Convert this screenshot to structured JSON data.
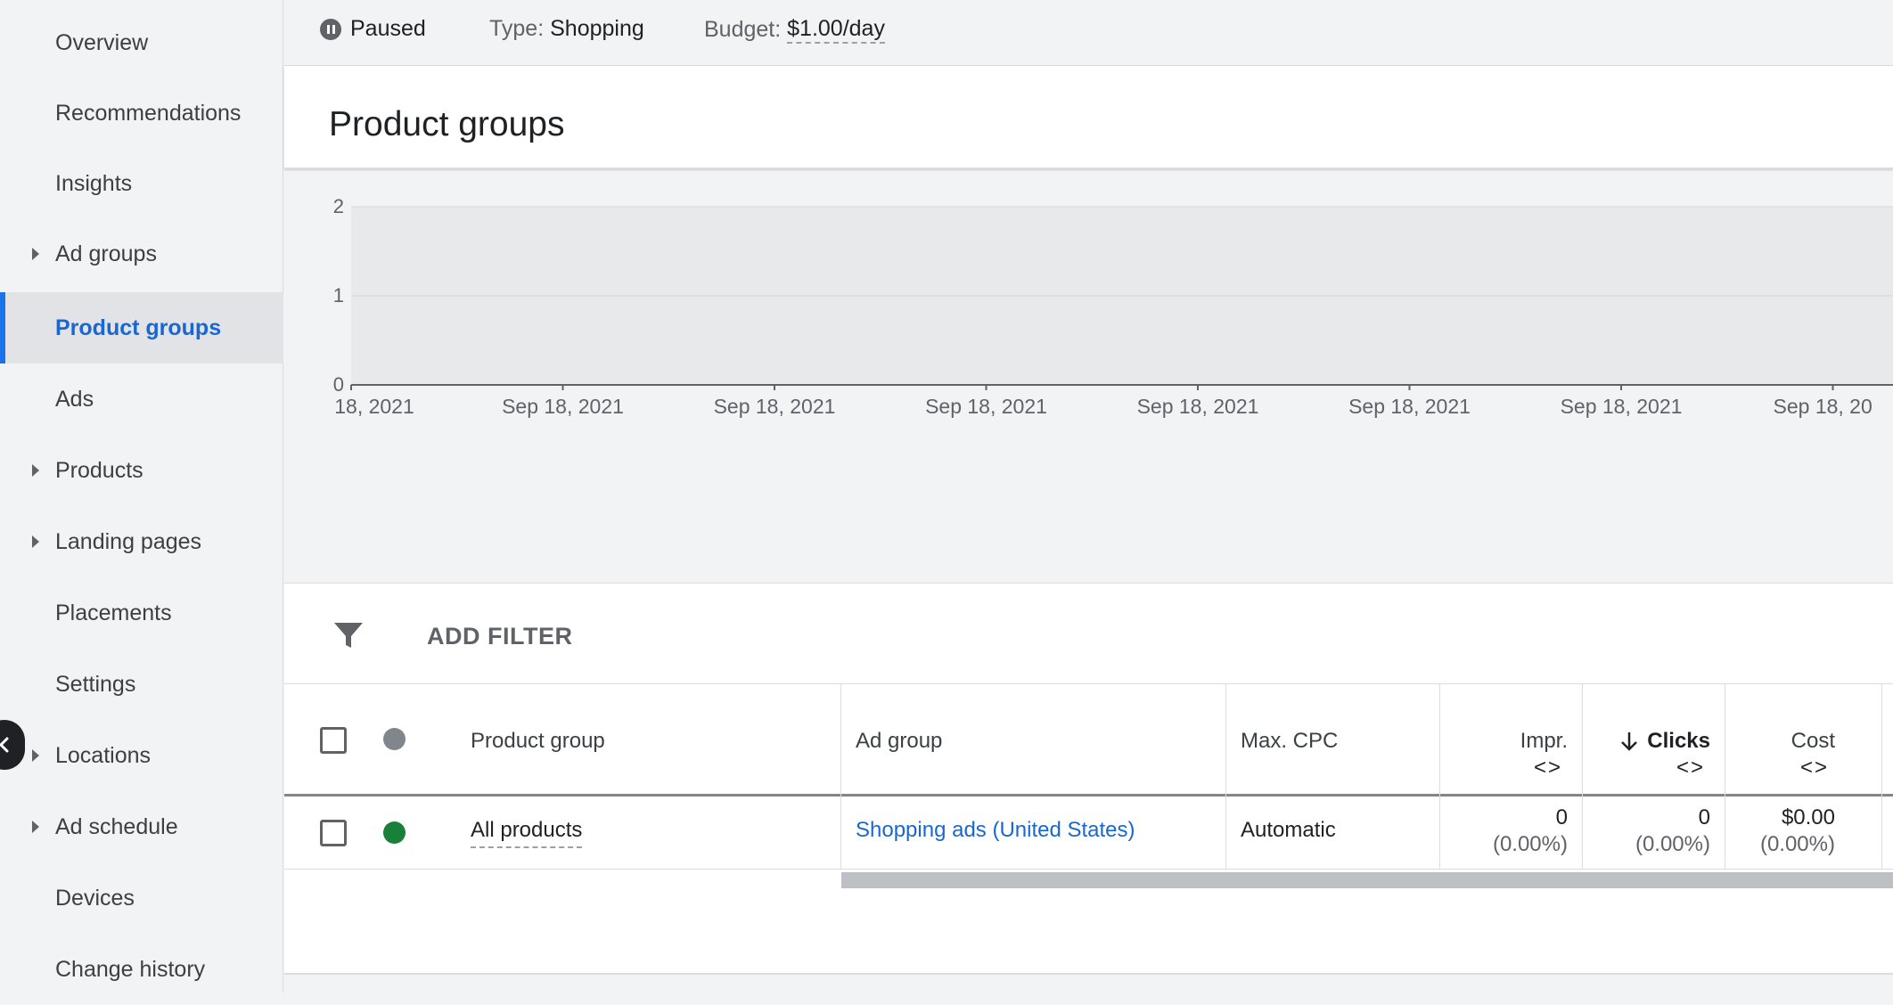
{
  "sidebar": {
    "items": [
      {
        "label": "Overview",
        "expandable": false,
        "active": false
      },
      {
        "label": "Recommendations",
        "expandable": false,
        "active": false
      },
      {
        "label": "Insights",
        "expandable": false,
        "active": false
      },
      {
        "label": "Ad groups",
        "expandable": true,
        "active": false
      },
      {
        "label": "Product groups",
        "expandable": false,
        "active": true
      },
      {
        "label": "Ads",
        "expandable": false,
        "active": false
      },
      {
        "label": "Products",
        "expandable": true,
        "active": false
      },
      {
        "label": "Landing pages",
        "expandable": true,
        "active": false
      },
      {
        "label": "Placements",
        "expandable": false,
        "active": false
      },
      {
        "label": "Settings",
        "expandable": false,
        "active": false
      },
      {
        "label": "Locations",
        "expandable": true,
        "active": false
      },
      {
        "label": "Ad schedule",
        "expandable": true,
        "active": false
      },
      {
        "label": "Devices",
        "expandable": false,
        "active": false
      },
      {
        "label": "Change history",
        "expandable": false,
        "active": false
      }
    ]
  },
  "status": {
    "state": "Paused",
    "type_label": "Type:",
    "type_value": "Shopping",
    "budget_label": "Budget:",
    "budget_value": "$1.00/day"
  },
  "page": {
    "title": "Product groups"
  },
  "chart_data": {
    "type": "line",
    "title": "",
    "xlabel": "",
    "ylabel": "",
    "y_ticks": [
      "0",
      "1",
      "2"
    ],
    "ylim": [
      0,
      2
    ],
    "x_ticks": [
      "18, 2021",
      "Sep 18, 2021",
      "Sep 18, 2021",
      "Sep 18, 2021",
      "Sep 18, 2021",
      "Sep 18, 2021",
      "Sep 18, 2021",
      "Sep 18, 20"
    ],
    "series": [],
    "grid": true
  },
  "filter": {
    "label": "ADD FILTER"
  },
  "table": {
    "headers": {
      "product_group": "Product group",
      "ad_group": "Ad group",
      "max_cpc": "Max. CPC",
      "impr": "Impr.",
      "clicks": "Clicks",
      "cost": "Cost",
      "resize": "<>"
    },
    "rows": [
      {
        "product_group": "All products",
        "ad_group": "Shopping ads (United States)",
        "max_cpc": "Automatic",
        "impr": "0",
        "impr_pct": "(0.00%)",
        "clicks": "0",
        "clicks_pct": "(0.00%)",
        "cost": "$0.00",
        "cost_pct": "(0.00%)",
        "status_color": "#188038"
      }
    ]
  },
  "colors": {
    "accent": "#1a73e8",
    "active_text": "#1967d2",
    "enabled": "#188038",
    "status_header_dot": "#80868b"
  }
}
